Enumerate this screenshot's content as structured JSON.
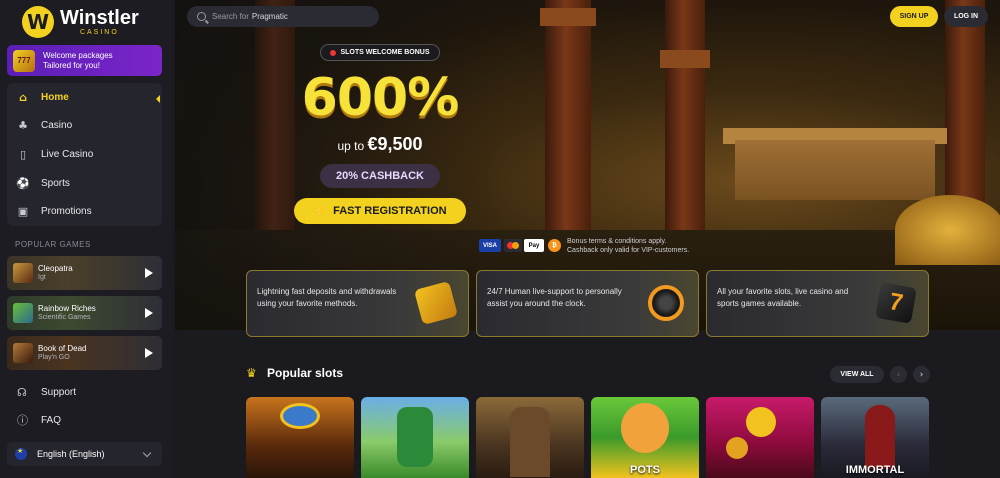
{
  "brand": {
    "name": "Winstler",
    "sub": "CASINO",
    "mark": "W"
  },
  "welcome": {
    "line1": "Welcome packages",
    "line2": "Tailored for you!",
    "icon": "777"
  },
  "nav": [
    {
      "label": "Home",
      "icon": "home-icon",
      "glyph": "⌂"
    },
    {
      "label": "Casino",
      "icon": "cherries-icon",
      "glyph": "♣"
    },
    {
      "label": "Live Casino",
      "icon": "cards-icon",
      "glyph": "▯"
    },
    {
      "label": "Sports",
      "icon": "football-icon",
      "glyph": "⚽"
    },
    {
      "label": "Promotions",
      "icon": "gift-icon",
      "glyph": "▣"
    }
  ],
  "popular_games": {
    "title": "POPULAR GAMES",
    "items": [
      {
        "name": "Cleopatra",
        "provider": "Igt"
      },
      {
        "name": "Rainbow Riches",
        "provider": "Scientific Games"
      },
      {
        "name": "Book of Dead",
        "provider": "Play'n GO"
      }
    ]
  },
  "links": {
    "support": "Support",
    "faq": "FAQ"
  },
  "language": "English (English)",
  "search": {
    "placeholder": "Search for",
    "highlight": "Pragmatic"
  },
  "header": {
    "signup": "SIGN UP",
    "login": "LOG IN"
  },
  "hero": {
    "tag": "SLOTS WELCOME BONUS",
    "percent": "600%",
    "upto_prefix": "up to",
    "upto_amount": "€9,500",
    "cashback": "20% CASHBACK",
    "cta": "FAST REGISTRATION",
    "terms1": "Bonus terms & conditions apply.",
    "terms2": "Cashback only valid for VIP-customers.",
    "payments": [
      "VISA",
      "",
      "Pay",
      "₿"
    ]
  },
  "features": [
    "Lightning fast deposits and withdrawals using your favorite methods.",
    "24/7 Human live-support to personally assist you around the clock.",
    "All your favorite slots, live casino and sports games available."
  ],
  "popular_slots": {
    "title": "Popular slots",
    "view_all": "VIEW ALL",
    "prev": "‹",
    "next": "›",
    "tiles": [
      "",
      "",
      "",
      "POTS",
      "",
      "IMMORTAL"
    ]
  },
  "colors": {
    "accent": "#f2d21f",
    "background": "#1a1a1f",
    "sidebar": "#1c1c22",
    "promo": "#6a20c0"
  }
}
